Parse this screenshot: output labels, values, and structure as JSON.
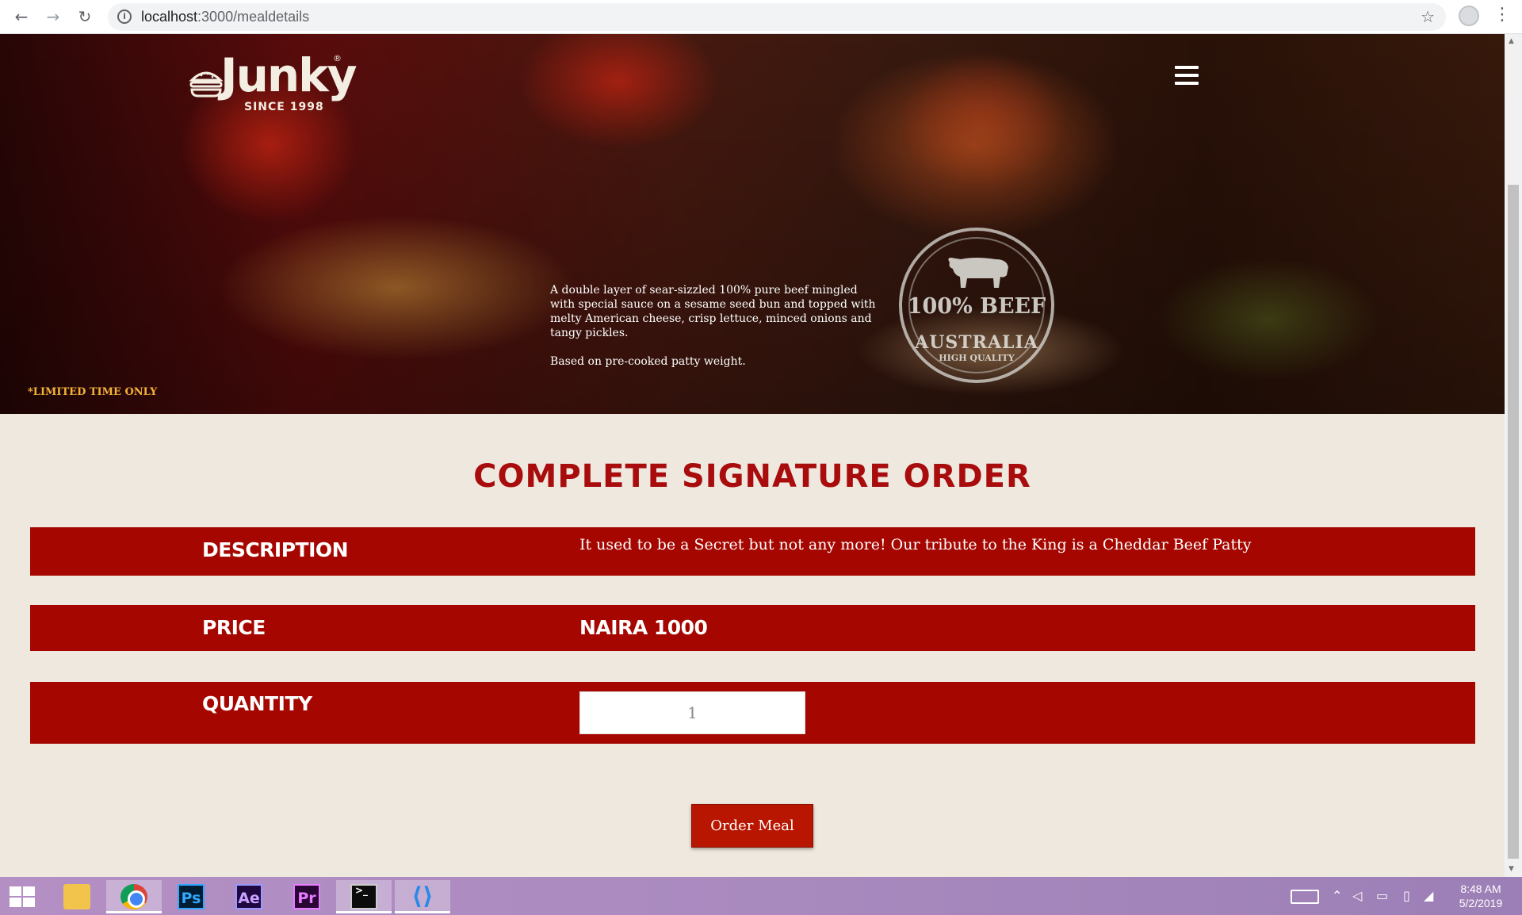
{
  "browser": {
    "url_host": "localhost",
    "url_path": ":3000/mealdetails",
    "back_icon": "arrow-back-icon",
    "forward_icon": "arrow-forward-icon",
    "reload_icon": "reload-icon"
  },
  "hero": {
    "logo_text": "Junky",
    "logo_reg": "®",
    "logo_since": "SINCE 1998",
    "description": "A double layer of sear-sizzled 100% pure beef mingled with special sauce on a sesame seed bun and topped with melty American cheese, crisp lettuce, minced onions and tangy pickles.",
    "note": "Based on pre-cooked patty weight.",
    "stamp_main": "100% BEEF",
    "stamp_sub": "AUSTRALIA",
    "stamp_small": "HIGH QUALITY",
    "limited": "*LIMITED TIME ONLY"
  },
  "order": {
    "title": "COMPLETE SIGNATURE ORDER",
    "description_label": "DESCRIPTION",
    "description_value": "It used to be a Secret but not any more! Our tribute to the King is a Cheddar Beef Patty",
    "price_label": "PRICE",
    "price_value": "NAIRA 1000",
    "quantity_label": "QUANTITY",
    "quantity_value": "1",
    "order_button": "Order Meal"
  },
  "colors": {
    "accent": "#a50600",
    "title": "#a80c0c",
    "page_bg": "#efe8de",
    "limited": "#f2b33a"
  },
  "taskbar": {
    "apps": [
      "start-icon",
      "file-explorer-icon",
      "chrome-icon",
      "photoshop-icon",
      "after-effects-icon",
      "premiere-icon",
      "terminal-icon",
      "vscode-icon"
    ],
    "ps": "Ps",
    "ae": "Ae",
    "pr": "Pr",
    "time": "8:48 AM",
    "date": "5/2/2019"
  }
}
